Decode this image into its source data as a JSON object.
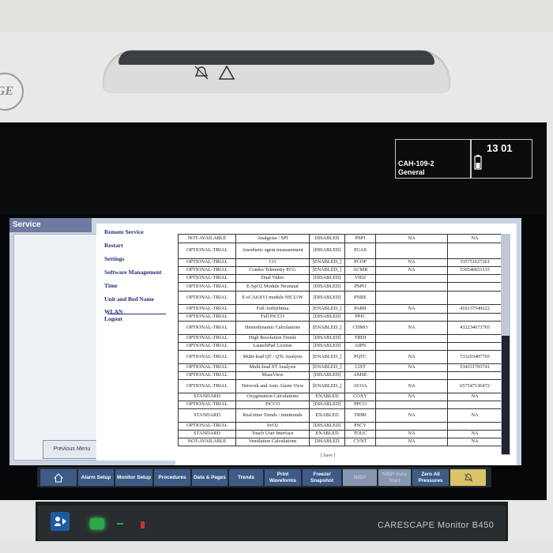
{
  "device": {
    "logo": "GE",
    "model": "CARESCAPE Monitor B450"
  },
  "header": {
    "patient_line1": "CAH-109-2",
    "patient_line2": "General",
    "time": "13 01"
  },
  "window": {
    "title": "Service"
  },
  "nav": {
    "items": [
      "Remote Service",
      "Restart",
      "Settings",
      "Software Management",
      "Time",
      "Unit and Bed Name",
      "WLAN",
      "Logout"
    ],
    "previous_menu": "Previous Menu"
  },
  "options_table": {
    "rows": [
      [
        "NOT-AVAILABLE",
        "Analgesia / SPI",
        "DISABLED",
        "PSPI",
        "NA",
        "NA"
      ],
      [
        "OPTIONAL-TRIAL",
        "Anesthetic agent measurement",
        "[DISABLED]",
        "PGAS",
        "",
        ""
      ],
      [
        "OPTIONAL-TRIAL",
        "CO",
        "[ENABLED_]",
        "PCOP",
        "NA",
        "335751627261"
      ],
      [
        "OPTIONAL-TRIAL",
        "Combo Telemetry ECG",
        "[ENABLED_]",
        "ACMB",
        "NA",
        "536546651133"
      ],
      [
        "OPTIONAL-TRIAL",
        "Dual Video",
        "[DISABLED]",
        "VID2",
        "",
        ""
      ],
      [
        "OPTIONAL-TRIAL",
        "E-SpO2 Module Neonatal",
        "[DISABLED]",
        "PSPO",
        "",
        ""
      ],
      [
        "OPTIONAL-TRIAL",
        "E-sCAiO(V) module NICU/W",
        "[DISABLED]",
        "PNRE",
        "",
        ""
      ],
      [
        "OPTIONAL-TRIAL",
        "Full Arrhythmia",
        "[ENABLED_]",
        "PARR",
        "NA",
        "416137540622"
      ],
      [
        "OPTIONAL-TRIAL",
        "Full PiCCO",
        "[DISABLED]",
        "PPIC",
        "",
        ""
      ],
      [
        "OPTIONAL-TRIAL",
        "Hemodynamic Calculations",
        "[ENABLED_]",
        "CHMO",
        "NA",
        "432234673765"
      ],
      [
        "OPTIONAL-TRIAL",
        "High Resolution Trends",
        "[DISABLED]",
        "TRHI",
        "",
        ""
      ],
      [
        "OPTIONAL-TRIAL",
        "LaunchPad License",
        "[DISABLED]",
        "AIPN",
        "",
        ""
      ],
      [
        "OPTIONAL-TRIAL",
        "Multi-lead QT / QTc Analysis",
        "[ENABLED_]",
        "PQTC",
        "NA",
        "733203407765"
      ],
      [
        "OPTIONAL-TRIAL",
        "Multi-lead ST Analysis",
        "[ENABLED_]",
        "12ST",
        "NA",
        "534331705741"
      ],
      [
        "OPTIONAL-TRIAL",
        "MuseView",
        "[DISABLED]",
        "AMSE",
        "",
        ""
      ],
      [
        "OPTIONAL-TRIAL",
        "Network and Auto Alarm View",
        "[ENABLED_]",
        "AVOA",
        "NA",
        "657547136472"
      ],
      [
        "STANDARD",
        "Oxygenation Calculations",
        "ENABLED",
        "COXY",
        "NA",
        "NA"
      ],
      [
        "OPTIONAL-TRIAL",
        "PiCCO",
        "[DISABLED]",
        "PPCO",
        "",
        ""
      ],
      [
        "STANDARD",
        "Real-time Trends / minitrends",
        "ENABLED",
        "TRMI",
        "NA",
        "NA"
      ],
      [
        "OPTIONAL-TRIAL",
        "SvO2",
        "[DISABLED]",
        "PSCV",
        "",
        ""
      ],
      [
        "STANDARD",
        "Touch User Interface",
        "ENABLED",
        "TOUC",
        "NA",
        "NA"
      ],
      [
        "NOT-AVAILABLE",
        "Ventilation Calculations",
        "DISABLED",
        "CVNT",
        "NA",
        "NA"
      ]
    ],
    "save_label": "[ Save ]"
  },
  "toolbar": {
    "buttons": [
      {
        "label": "",
        "icon": "home-icon",
        "enabled": true
      },
      {
        "label": "Alarm Setup",
        "enabled": true
      },
      {
        "label": "Monitor Setup",
        "enabled": true
      },
      {
        "label": "Procedures",
        "enabled": true
      },
      {
        "label": "Data & Pages",
        "enabled": true
      },
      {
        "label": "Trends",
        "enabled": true
      },
      {
        "label": "Print Waveforms",
        "enabled": true
      },
      {
        "label": "Freeze/ Snapshot",
        "enabled": true
      },
      {
        "label": "NIBP",
        "enabled": false
      },
      {
        "label": "NIBP Auto Start",
        "enabled": false
      },
      {
        "label": "Zero All Pressures",
        "enabled": true
      },
      {
        "label": "",
        "icon": "alarm-bell-icon",
        "enabled": true
      }
    ]
  },
  "colors": {
    "toolbar_button": "#3d5b86",
    "window_title": "#6e7aa0",
    "nav_text": "#26307a",
    "alarm_button": "#d9c46a"
  }
}
